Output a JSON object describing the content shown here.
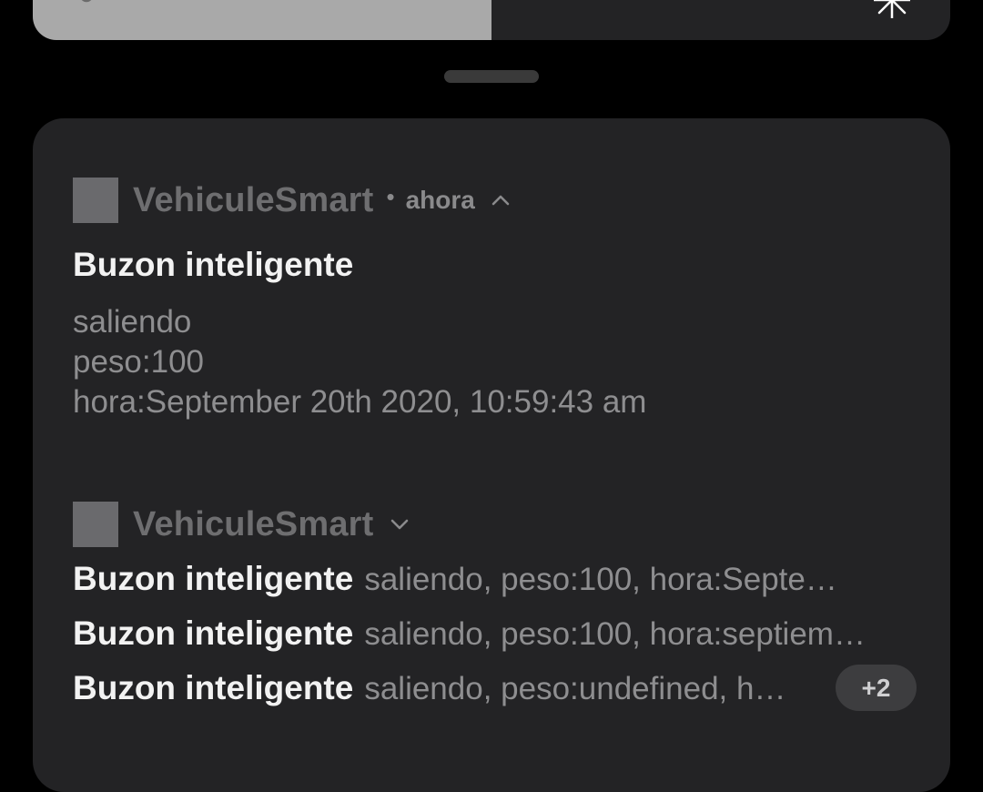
{
  "quick_settings": {
    "brightness_level": 0.5
  },
  "notification_group": {
    "expanded": {
      "app_name": "VehiculeSmart",
      "separator": "•",
      "time": "ahora",
      "title": "Buzon inteligente",
      "lines": [
        "saliendo",
        "peso:100",
        "hora:September 20th 2020, 10:59:43 am"
      ]
    },
    "collapsed": {
      "app_name": "VehiculeSmart",
      "items": [
        {
          "title": "Buzon inteligente",
          "text": "saliendo,  peso:100,   hora:Septe…"
        },
        {
          "title": "Buzon inteligente",
          "text": "saliendo, peso:100, hora:septiem…"
        },
        {
          "title": "Buzon inteligente",
          "text": "saliendo, peso:undefined, h…"
        }
      ],
      "more_badge": "+2"
    }
  }
}
